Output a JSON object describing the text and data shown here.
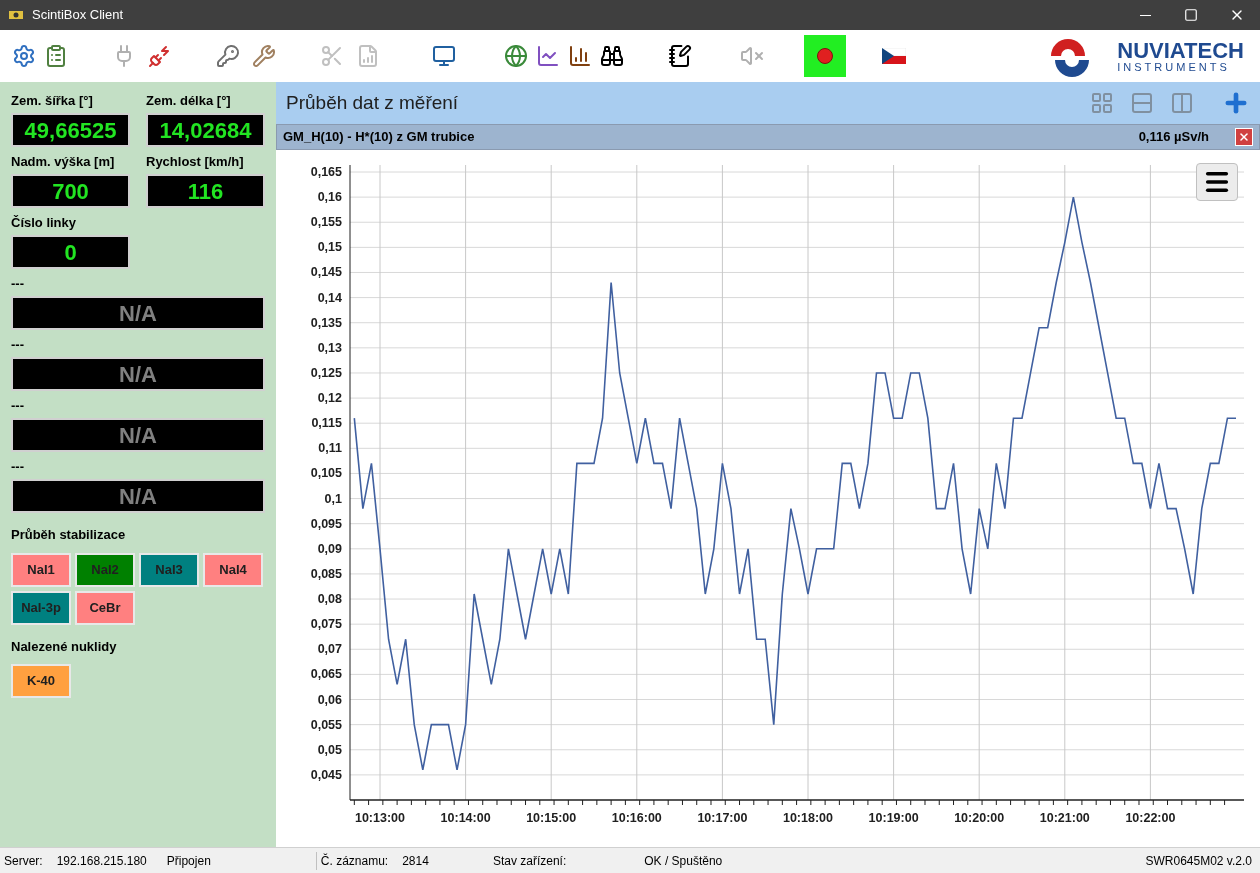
{
  "window": {
    "title": "ScintiBox Client"
  },
  "logo": {
    "name": "NUVIATECH",
    "sub": "INSTRUMENTS"
  },
  "readouts": [
    {
      "label": "Zem. šířka [°]",
      "value": "49,66525",
      "kind": "half"
    },
    {
      "label": "Zem. délka [°]",
      "value": "14,02684",
      "kind": "half"
    },
    {
      "label": "Nadm. výška [m]",
      "value": "700",
      "kind": "half"
    },
    {
      "label": "Rychlost [km/h]",
      "value": "116",
      "kind": "half"
    },
    {
      "label": "Číslo linky",
      "value": "0",
      "kind": "half"
    },
    {
      "label": "---",
      "value": "N/A",
      "kind": "wide"
    },
    {
      "label": "---",
      "value": "N/A",
      "kind": "wide"
    },
    {
      "label": "---",
      "value": "N/A",
      "kind": "wide"
    },
    {
      "label": "---",
      "value": "N/A",
      "kind": "wide"
    }
  ],
  "stabilization": {
    "title": "Průběh stabilizace",
    "items": [
      {
        "label": "NaI1",
        "color": "#ff8080"
      },
      {
        "label": "NaI2",
        "color": "#008000"
      },
      {
        "label": "NaI3",
        "color": "#008080"
      },
      {
        "label": "NaI4",
        "color": "#ff8080"
      },
      {
        "label": "NaI-3p",
        "color": "#008080"
      },
      {
        "label": "CeBr",
        "color": "#ff8080"
      }
    ]
  },
  "nuclides": {
    "title": "Nalezené nuklidy",
    "items": [
      {
        "label": "K-40",
        "color": "#ffa040"
      }
    ]
  },
  "panel": {
    "title": "Průběh dat z měření"
  },
  "series_header": {
    "name": "GM_H(10) - H*(10) z GM trubice",
    "reading": "0,116 µSv/h"
  },
  "chart_data": {
    "type": "line",
    "categories": [
      null,
      null,
      null,
      "10:13:00",
      null,
      null,
      null,
      null,
      null,
      null,
      null,
      null,
      null,
      "10:14:00",
      null,
      null,
      null,
      null,
      null,
      null,
      null,
      null,
      null,
      "10:15:00",
      null,
      null,
      null,
      null,
      null,
      null,
      null,
      null,
      null,
      "10:16:00",
      null,
      null,
      null,
      null,
      null,
      null,
      null,
      null,
      null,
      "10:17:00",
      null,
      null,
      null,
      null,
      null,
      null,
      null,
      null,
      null,
      "10:18:00",
      null,
      null,
      null,
      null,
      null,
      null,
      null,
      null,
      null,
      "10:19:00",
      null,
      null,
      null,
      null,
      null,
      null,
      null,
      null,
      null,
      "10:20:00",
      null,
      null,
      null,
      null,
      null,
      null,
      null,
      null,
      null,
      "10:21:00",
      null,
      null,
      null,
      null,
      null,
      null,
      null,
      null,
      null,
      "10:22:00",
      null,
      null,
      null,
      null,
      null,
      null,
      null,
      null,
      null,
      null
    ],
    "series": [
      {
        "color": "#4060a0",
        "values": [
          0.116,
          0.098,
          0.107,
          0.09,
          0.072,
          0.063,
          0.072,
          0.055,
          0.046,
          0.055,
          0.055,
          0.055,
          0.046,
          0.055,
          0.081,
          0.072,
          0.063,
          0.072,
          0.09,
          0.081,
          0.072,
          0.081,
          0.09,
          0.081,
          0.09,
          0.081,
          0.107,
          0.107,
          0.107,
          0.116,
          0.143,
          0.125,
          0.116,
          0.107,
          0.116,
          0.107,
          0.107,
          0.098,
          0.116,
          0.107,
          0.098,
          0.081,
          0.09,
          0.107,
          0.098,
          0.081,
          0.09,
          0.072,
          0.072,
          0.055,
          0.081,
          0.098,
          0.09,
          0.081,
          0.09,
          0.09,
          0.09,
          0.107,
          0.107,
          0.098,
          0.107,
          0.125,
          0.125,
          0.116,
          0.116,
          0.125,
          0.125,
          0.116,
          0.098,
          0.098,
          0.107,
          0.09,
          0.081,
          0.098,
          0.09,
          0.107,
          0.098,
          0.116,
          0.116,
          0.125,
          0.134,
          0.134,
          0.143,
          0.151,
          0.16,
          0.151,
          0.143,
          0.134,
          0.125,
          0.116,
          0.116,
          0.107,
          0.107,
          0.098,
          0.107,
          0.098,
          0.098,
          0.09,
          0.081,
          0.098,
          0.107,
          0.107,
          0.116,
          0.116
        ]
      }
    ],
    "ylim": [
      0.04,
      0.165
    ],
    "grid": true,
    "yticks": [
      {
        "value": 0.045,
        "label": "0,045"
      },
      {
        "value": 0.05,
        "label": "0,05"
      },
      {
        "value": 0.055,
        "label": "0,055"
      },
      {
        "value": 0.06,
        "label": "0,06"
      },
      {
        "value": 0.065,
        "label": "0,065"
      },
      {
        "value": 0.07,
        "label": "0,07"
      },
      {
        "value": 0.075,
        "label": "0,075"
      },
      {
        "value": 0.08,
        "label": "0,08"
      },
      {
        "value": 0.085,
        "label": "0,085"
      },
      {
        "value": 0.09,
        "label": "0,09"
      },
      {
        "value": 0.095,
        "label": "0,095"
      },
      {
        "value": 0.1,
        "label": "0,1"
      },
      {
        "value": 0.105,
        "label": "0,105"
      },
      {
        "value": 0.11,
        "label": "0,11"
      },
      {
        "value": 0.115,
        "label": "0,115"
      },
      {
        "value": 0.12,
        "label": "0,12"
      },
      {
        "value": 0.125,
        "label": "0,125"
      },
      {
        "value": 0.13,
        "label": "0,13"
      },
      {
        "value": 0.135,
        "label": "0,135"
      },
      {
        "value": 0.14,
        "label": "0,14"
      },
      {
        "value": 0.145,
        "label": "0,145"
      },
      {
        "value": 0.15,
        "label": "0,15"
      },
      {
        "value": 0.155,
        "label": "0,155"
      },
      {
        "value": 0.16,
        "label": "0,16"
      },
      {
        "value": 0.165,
        "label": "0,165"
      }
    ]
  },
  "status_bar": [
    {
      "text": "Server:",
      "kind": "label"
    },
    {
      "text": "192.168.215.180",
      "kind": "value"
    },
    {
      "text": "Připojen",
      "kind": "value"
    },
    {
      "text": "Č. záznamu:",
      "kind": "label"
    },
    {
      "text": "2814",
      "kind": "value"
    },
    {
      "text": "Stav zařízení:",
      "kind": "label"
    },
    {
      "text": "OK / Spuštěno",
      "kind": "value"
    },
    {
      "text": "SWR0645M02 v.2.0",
      "kind": "end"
    }
  ]
}
